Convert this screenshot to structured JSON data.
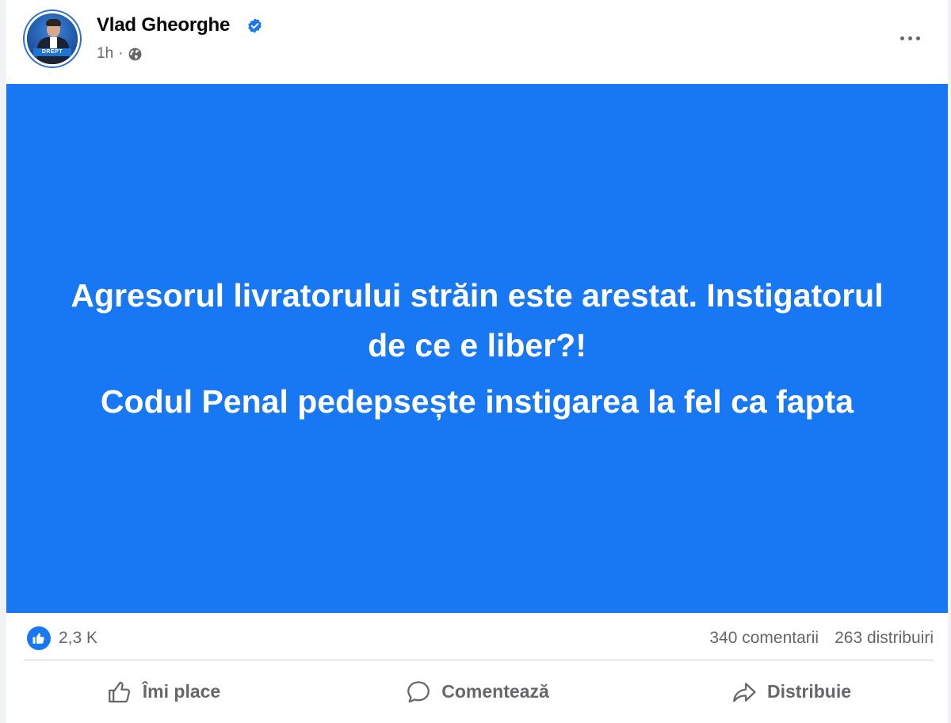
{
  "post": {
    "author": "Vlad Gheorghe",
    "verified": true,
    "time": "1h",
    "separator": "·",
    "visibility_icon": "globe-icon",
    "avatar_tag": "DREPT",
    "more_icon": "more-options-icon",
    "background_color": "#1877f2",
    "text_color": "#ffffff",
    "paragraphs": [
      "Agresorul livratorului străin este arestat. Instigatorul de ce e liber?!",
      "Codul Penal pedepsește instigarea la fel ca fapta"
    ]
  },
  "stats": {
    "reaction_icon": "like-icon",
    "reactions": "2,3 K",
    "comments": "340 comentarii",
    "shares": "263 distribuiri"
  },
  "actions": {
    "like": "Îmi place",
    "comment": "Comentează",
    "share": "Distribuie"
  },
  "colors": {
    "accent": "#1877f2",
    "secondary_text": "#65676b",
    "primary_text": "#050505"
  }
}
